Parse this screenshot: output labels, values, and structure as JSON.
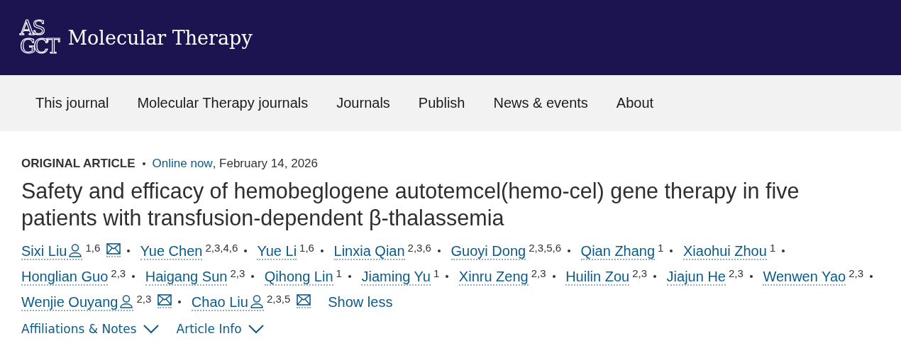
{
  "header": {
    "logo_lines": [
      "AS",
      "GCT"
    ],
    "title": "Molecular Therapy"
  },
  "nav": [
    {
      "label": "This journal"
    },
    {
      "label": "Molecular Therapy journals"
    },
    {
      "label": "Journals"
    },
    {
      "label": "Publish"
    },
    {
      "label": "News & events"
    },
    {
      "label": "About"
    }
  ],
  "article": {
    "type": "ORIGINAL ARTICLE",
    "status": "Online now",
    "date": ", February 14, 2026",
    "title": "Safety and efficacy of hemobeglogene autotemcel(hemo-cel) gene therapy in five patients with transfusion-dependent β-thalassemia",
    "authors": [
      {
        "name": "Sixi Liu",
        "corresponding": true,
        "affiliations": "1,6",
        "email": true
      },
      {
        "name": "Yue Chen",
        "corresponding": false,
        "affiliations": "2,3,4,6",
        "email": false
      },
      {
        "name": "Yue Li",
        "corresponding": false,
        "affiliations": "1,6",
        "email": false
      },
      {
        "name": "Linxia Qian",
        "corresponding": false,
        "affiliations": "2,3,6",
        "email": false
      },
      {
        "name": "Guoyi Dong",
        "corresponding": false,
        "affiliations": "2,3,5,6",
        "email": false
      },
      {
        "name": "Qian Zhang",
        "corresponding": false,
        "affiliations": "1",
        "email": false
      },
      {
        "name": "Xiaohui Zhou",
        "corresponding": false,
        "affiliations": "1",
        "email": false
      },
      {
        "name": "Honglian Guo",
        "corresponding": false,
        "affiliations": "2,3",
        "email": false
      },
      {
        "name": "Haigang Sun",
        "corresponding": false,
        "affiliations": "2,3",
        "email": false
      },
      {
        "name": "Qihong Lin",
        "corresponding": false,
        "affiliations": "1",
        "email": false
      },
      {
        "name": "Jiaming Yu",
        "corresponding": false,
        "affiliations": "1",
        "email": false
      },
      {
        "name": "Xinru Zeng",
        "corresponding": false,
        "affiliations": "2,3",
        "email": false
      },
      {
        "name": "Huilin Zou",
        "corresponding": false,
        "affiliations": "2,3",
        "email": false
      },
      {
        "name": "Jiajun He",
        "corresponding": false,
        "affiliations": "2,3",
        "email": false
      },
      {
        "name": "Wenwen Yao",
        "corresponding": false,
        "affiliations": "2,3",
        "email": false
      },
      {
        "name": "Wenjie Ouyang",
        "corresponding": true,
        "affiliations": "2,3",
        "email": true
      },
      {
        "name": "Chao Liu",
        "corresponding": true,
        "affiliations": "2,3,5",
        "email": true
      }
    ],
    "show_less": "Show less",
    "sections": [
      {
        "label": "Affiliations & Notes",
        "expanded": false
      },
      {
        "label": "Article Info",
        "expanded": false
      }
    ]
  }
}
